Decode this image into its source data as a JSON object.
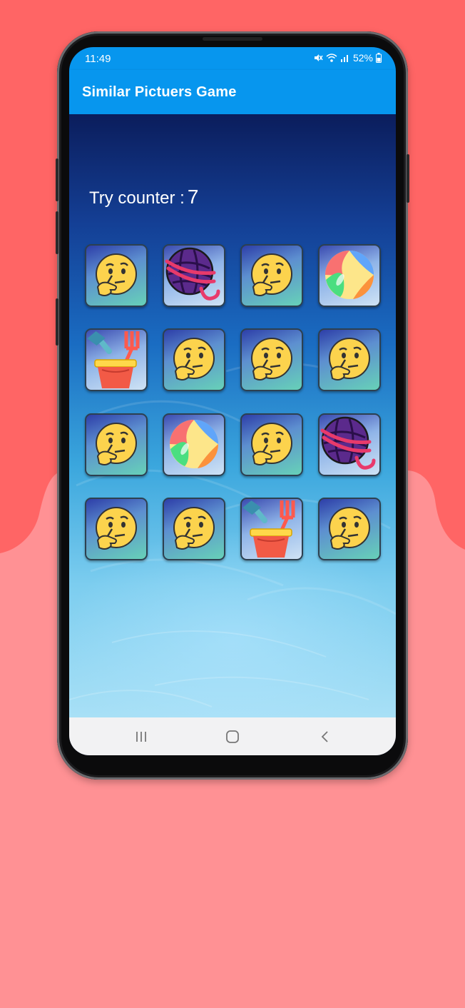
{
  "status_bar": {
    "time": "11:49",
    "battery": "52%",
    "icons": [
      "mute-icon",
      "wifi-icon",
      "signal-icon",
      "battery-icon"
    ]
  },
  "app": {
    "title": "Similar Pictuers Game",
    "try_counter_label": "Try counter :",
    "try_counter_value": "7"
  },
  "colors": {
    "app_bar": "#0796ee",
    "background_top": "#ff6565",
    "background_bottom": "#ff9194"
  },
  "grid": {
    "rows": 4,
    "columns": 4,
    "cards": [
      [
        "thinking-face",
        "yarn-ball",
        "thinking-face",
        "beach-ball"
      ],
      [
        "sand-bucket",
        "thinking-face",
        "thinking-face",
        "thinking-face"
      ],
      [
        "thinking-face",
        "beach-ball",
        "thinking-face",
        "yarn-ball"
      ],
      [
        "thinking-face",
        "thinking-face",
        "sand-bucket",
        "thinking-face"
      ]
    ]
  },
  "nav_bar": {
    "buttons": [
      "recents-icon",
      "home-icon",
      "back-icon"
    ]
  }
}
